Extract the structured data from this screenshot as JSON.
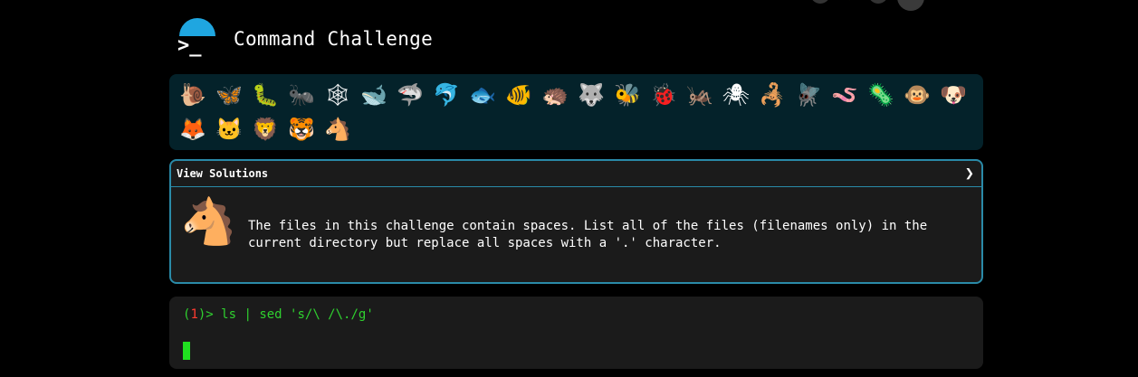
{
  "header": {
    "title": "Command Challenge"
  },
  "animals": [
    {
      "name": "snail",
      "glyph": "🐌"
    },
    {
      "name": "butterfly",
      "glyph": "🦋"
    },
    {
      "name": "caterpillar",
      "glyph": "🐛"
    },
    {
      "name": "ant",
      "glyph": "🐜"
    },
    {
      "name": "spider-web",
      "glyph": "🕸"
    },
    {
      "name": "whale",
      "glyph": "🐋"
    },
    {
      "name": "shark",
      "glyph": "🦈"
    },
    {
      "name": "dolphin",
      "glyph": "🐬"
    },
    {
      "name": "fish",
      "glyph": "🐟"
    },
    {
      "name": "tropical-fish",
      "glyph": "🐠"
    },
    {
      "name": "hedgehog",
      "glyph": "🦔"
    },
    {
      "name": "wolf",
      "glyph": "🐺"
    },
    {
      "name": "bee",
      "glyph": "🐝"
    },
    {
      "name": "ladybug",
      "glyph": "🐞"
    },
    {
      "name": "cricket",
      "glyph": "🦗"
    },
    {
      "name": "tick",
      "glyph": "🕷"
    },
    {
      "name": "scorpion",
      "glyph": "🦂"
    },
    {
      "name": "fly",
      "glyph": "🪰"
    },
    {
      "name": "worm",
      "glyph": "🪱"
    },
    {
      "name": "microbe",
      "glyph": "🦠"
    },
    {
      "name": "monkey",
      "glyph": "🐵"
    },
    {
      "name": "dog",
      "glyph": "🐶"
    },
    {
      "name": "fox",
      "glyph": "🦊"
    },
    {
      "name": "cat",
      "glyph": "🐱"
    },
    {
      "name": "lion",
      "glyph": "🦁"
    },
    {
      "name": "tiger",
      "glyph": "🐯"
    },
    {
      "name": "horse",
      "glyph": "🐴"
    }
  ],
  "card": {
    "header_label": "View Solutions",
    "chevron_glyph": "❯",
    "avatar_glyph": "🐴",
    "description": "The files in this challenge contain spaces. List all of the files (filenames only) in the current directory but replace all spaces with a '.' character."
  },
  "terminal": {
    "prompt_open": "(",
    "prompt_number": "1",
    "prompt_close": ")> ",
    "command": "ls | sed 's/\\ /\\./g'"
  },
  "colors": {
    "accent": "#2a8aa8",
    "strip_bg": "#04222a",
    "terminal_text": "#2fd12f",
    "prompt_number": "#ff3b30",
    "cursor": "#20e020"
  }
}
